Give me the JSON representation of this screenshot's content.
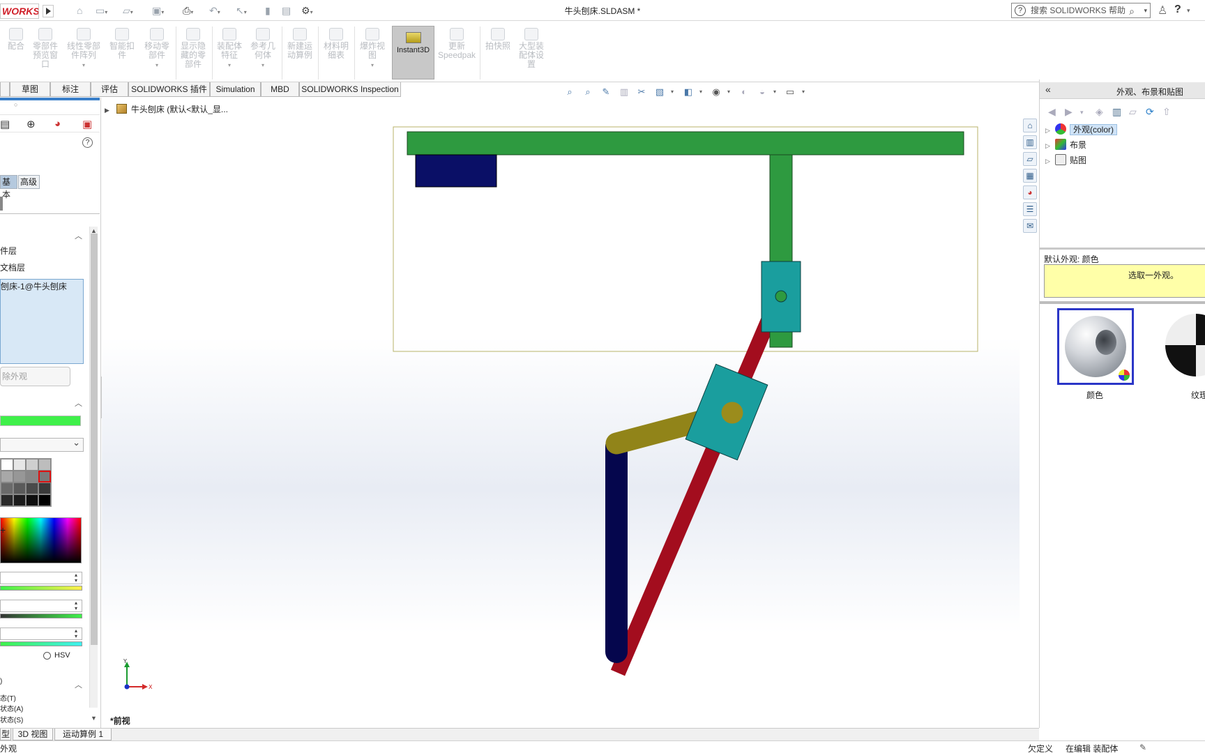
{
  "titlebar": {
    "logo_text": "WORKS",
    "document_title": "牛头刨床.SLDASM *",
    "search_placeholder": "搜索 SOLIDWORKS 帮助",
    "help_symbol": "?"
  },
  "command_manager": {
    "items": [
      {
        "label": "配合"
      },
      {
        "label": "零部件\n预览窗\n口"
      },
      {
        "label": "线性零部\n件阵列"
      },
      {
        "label": "智能扣\n件"
      },
      {
        "label": "移动零\n部件"
      },
      {
        "label": "显示隐\n藏的零\n部件"
      },
      {
        "label": "装配体\n特征"
      },
      {
        "label": "参考几\n何体"
      },
      {
        "label": "新建运\n动算例"
      },
      {
        "label": "材料明\n细表"
      },
      {
        "label": "爆炸视\n图"
      },
      {
        "label": "更新\nSpeedpak"
      },
      {
        "label": "拍快照"
      },
      {
        "label": "大型装\n配体设\n置"
      }
    ],
    "active_item": "Instant3D"
  },
  "tabs": [
    "草图",
    "标注",
    "评估",
    "SOLIDWORKS 插件",
    "Simulation",
    "MBD",
    "SOLIDWORKS Inspection"
  ],
  "property_manager": {
    "mode_basic": "基本",
    "mode_advanced": "高级",
    "level_part": "件层",
    "level_document": "文档层",
    "selected_entity": "刨床-1@牛头刨床",
    "remove_button": "除外观",
    "current_color": "#3ff04a",
    "hsv_label": "HSV",
    "state_items": [
      "态(T)",
      "状态(A)",
      "状态(S)"
    ]
  },
  "viewport": {
    "tree_root": "牛头刨床 (默认<默认_显...",
    "view_name": "*前视",
    "triad": {
      "x": "X",
      "y": "Y"
    },
    "colors": {
      "ram": "#2e9a40",
      "tool_block": "#0a0f66",
      "slider_block": "#1a9e9e",
      "rocker": "#a30d1e",
      "crank": "#a0901e",
      "link": "#05064d",
      "bbox": "#b8b36a"
    }
  },
  "task_pane": {
    "title": "外观、布景和贴图",
    "tree": [
      {
        "label": "外观(color)",
        "selected": true
      },
      {
        "label": "布景",
        "selected": false
      },
      {
        "label": "贴图",
        "selected": false
      }
    ],
    "default_appearance_label": "默认外观: 颜色",
    "hint": "选取一外观。",
    "thumbnails": [
      {
        "label": "颜色"
      },
      {
        "label": "纹理"
      }
    ]
  },
  "bottom_tabs": [
    "型",
    "3D 视图",
    "运动算例 1"
  ],
  "statusbar": {
    "left": "外观",
    "undefined": "欠定义",
    "editing": "在编辑 装配体"
  }
}
